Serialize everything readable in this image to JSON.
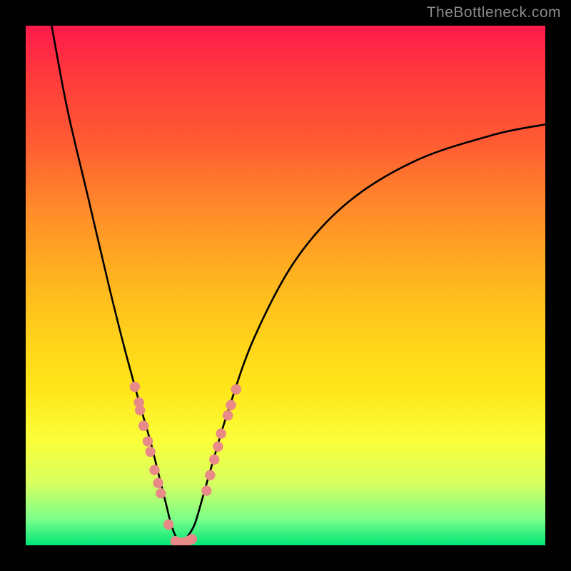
{
  "watermark": "TheBottleneck.com",
  "chart_data": {
    "type": "line",
    "title": "",
    "xlabel": "",
    "ylabel": "",
    "xlim": [
      0,
      100
    ],
    "ylim": [
      0,
      100
    ],
    "series": [
      {
        "name": "bottleneck-curve",
        "x": [
          5,
          8,
          12,
          16,
          19,
          22,
          24,
          25.5,
          27,
          28,
          29,
          30,
          31,
          32.5,
          34,
          36,
          39,
          44,
          52,
          62,
          75,
          90,
          100
        ],
        "y": [
          100,
          84,
          67,
          50,
          38,
          27,
          20,
          14,
          8,
          4,
          1.5,
          0.5,
          1.5,
          4,
          9,
          16,
          26,
          40,
          55,
          66,
          74,
          79,
          81
        ]
      }
    ],
    "dots": {
      "name": "highlight-dots",
      "color": "#e88a87",
      "points": [
        [
          21.0,
          30.5
        ],
        [
          21.8,
          27.5
        ],
        [
          22.0,
          26.0
        ],
        [
          22.7,
          23.0
        ],
        [
          23.5,
          20.0
        ],
        [
          24.0,
          18.0
        ],
        [
          24.8,
          14.5
        ],
        [
          25.5,
          12.0
        ],
        [
          26.0,
          10.0
        ],
        [
          27.5,
          4.0
        ],
        [
          28.8,
          0.8
        ],
        [
          29.6,
          0.5
        ],
        [
          30.4,
          0.5
        ],
        [
          31.2,
          0.8
        ],
        [
          32.0,
          1.2
        ],
        [
          34.8,
          10.5
        ],
        [
          35.5,
          13.5
        ],
        [
          36.3,
          16.5
        ],
        [
          37.0,
          19.0
        ],
        [
          37.6,
          21.5
        ],
        [
          38.9,
          25.0
        ],
        [
          39.5,
          27.0
        ],
        [
          40.5,
          30.0
        ]
      ]
    }
  }
}
